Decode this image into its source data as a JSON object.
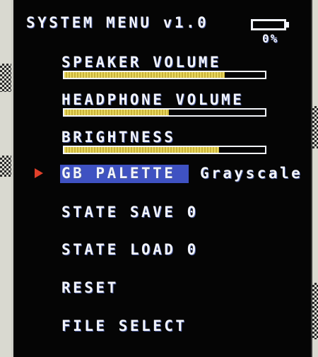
{
  "menu": {
    "title": "SYSTEM MENU v1.0",
    "battery": {
      "percent_label": "0%",
      "level": 0
    },
    "sliders": [
      {
        "label": "SPEAKER VOLUME",
        "level": 0.8
      },
      {
        "label": "HEADPHONE VOLUME",
        "level": 0.52
      },
      {
        "label": "BRIGHTNESS",
        "level": 0.77
      }
    ],
    "gb_palette": {
      "label": "GB PALETTE",
      "value": "Grayscale"
    },
    "state_save": "STATE SAVE 0",
    "state_load": "STATE LOAD 0",
    "reset": "RESET",
    "file_select": "FILE SELECT",
    "selected_item": "GB PALETTE"
  },
  "colors": {
    "panel_bg": "#050505",
    "text": "#f2f4fa",
    "highlight": "#3f52c2",
    "arrow": "#e0402a",
    "slider_fill": "#e8d860"
  }
}
